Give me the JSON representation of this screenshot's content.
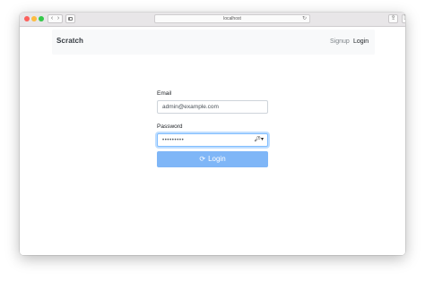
{
  "browser": {
    "address": "localhost",
    "reload_icon": "reload-icon",
    "back_glyph": "‹",
    "forward_glyph": "›",
    "share_glyph": "⇪",
    "tabs_glyph": "❐",
    "new_tab_glyph": "+"
  },
  "navbar": {
    "brand": "Scratch",
    "links": [
      {
        "label": "Signup"
      },
      {
        "label": "Login"
      }
    ]
  },
  "form": {
    "email_label": "Email",
    "email_value": "admin@example.com",
    "password_label": "Password",
    "password_value": "•••••••••",
    "password_manager_icon": "key-icon",
    "submit_label": "Login",
    "submit_icon": "spinner-icon"
  },
  "colors": {
    "primary_disabled": "#7fb6f7",
    "focus_border": "#80bdff",
    "navbar_bg": "#f8f9fa"
  }
}
